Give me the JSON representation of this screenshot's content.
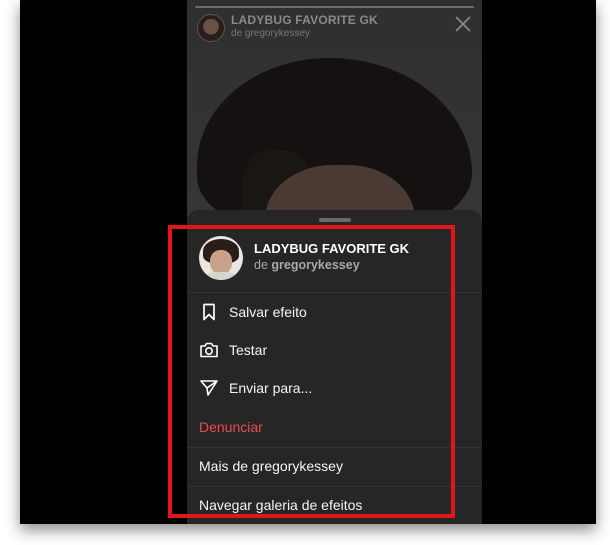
{
  "story": {
    "title": "LADYBUG FAVORITE GK",
    "subtitle": "de gregorykessey"
  },
  "sheet": {
    "title": "LADYBUG FAVORITE GK",
    "by_prefix": "de",
    "author": "gregorykessey",
    "items": [
      {
        "label": "Salvar efeito",
        "icon": "bookmark-icon"
      },
      {
        "label": "Testar",
        "icon": "camera-icon"
      },
      {
        "label": "Enviar para...",
        "icon": "send-icon"
      }
    ],
    "report_label": "Denunciar",
    "more_label": "Mais de gregorykessey",
    "gallery_label": "Navegar galeria de efeitos"
  },
  "colors": {
    "highlight": "#e0161b",
    "danger": "#ed4956",
    "sheet_bg": "#262626"
  }
}
